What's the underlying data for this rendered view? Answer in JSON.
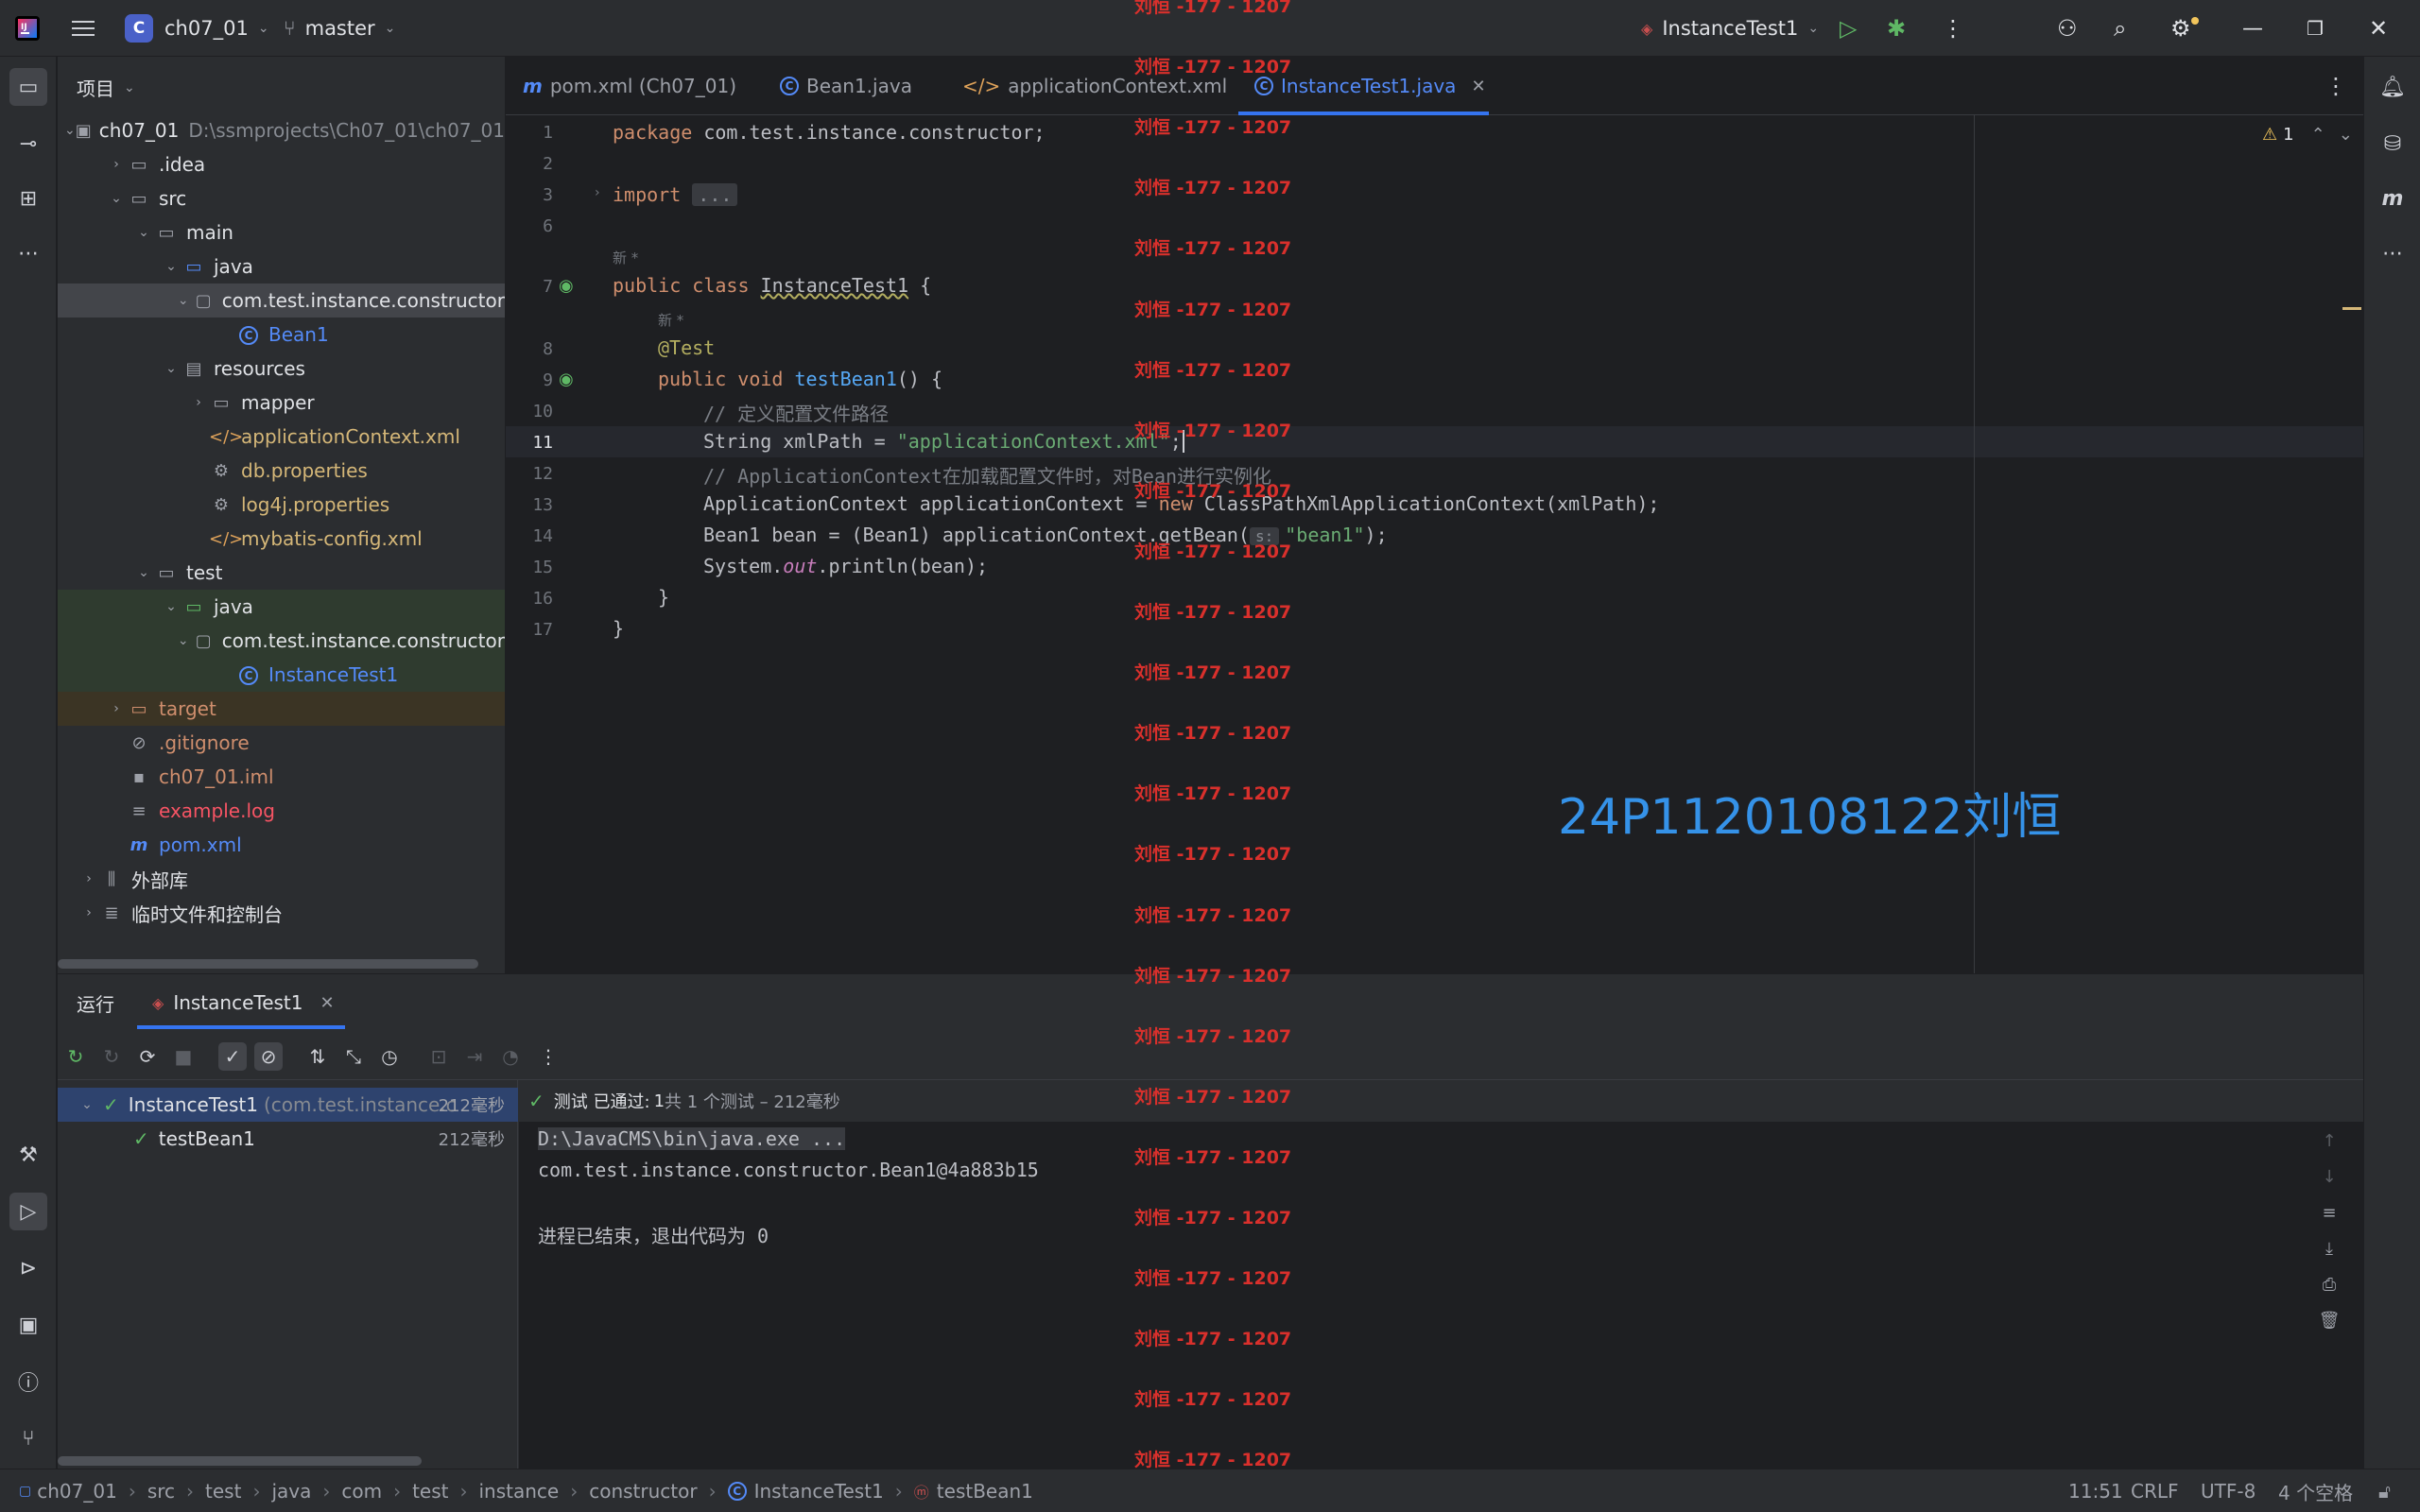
{
  "titlebar": {
    "project_badge": "C",
    "project_name": "ch07_01",
    "branch": "master",
    "run_config": "InstanceTest1"
  },
  "project_panel": {
    "title": "项目",
    "tree": [
      {
        "label": "ch07_01",
        "hint": "D:\\ssmprojects\\Ch07_01\\ch07_01",
        "depth": 0,
        "expanded": true,
        "icon": "module-folder-icon"
      },
      {
        "label": ".idea",
        "depth": 1,
        "expanded": false,
        "icon": "folder-icon"
      },
      {
        "label": "src",
        "depth": 1,
        "expanded": true,
        "icon": "folder-icon"
      },
      {
        "label": "main",
        "depth": 2,
        "expanded": true,
        "icon": "folder-icon"
      },
      {
        "label": "java",
        "depth": 3,
        "expanded": true,
        "icon": "source-folder-icon"
      },
      {
        "label": "com.test.instance.constructor",
        "depth": 4,
        "expanded": true,
        "icon": "package-icon",
        "selected": true
      },
      {
        "label": "Bean1",
        "depth": 5,
        "icon": "class-icon",
        "color": "blue"
      },
      {
        "label": "resources",
        "depth": 3,
        "expanded": true,
        "icon": "resources-folder-icon"
      },
      {
        "label": "mapper",
        "depth": 4,
        "expanded": false,
        "icon": "folder-icon"
      },
      {
        "label": "applicationContext.xml",
        "depth": 4,
        "icon": "xml-icon",
        "color": "yellow"
      },
      {
        "label": "db.properties",
        "depth": 4,
        "icon": "gear-icon",
        "color": "yellow"
      },
      {
        "label": "log4j.properties",
        "depth": 4,
        "icon": "gear-icon",
        "color": "yellow"
      },
      {
        "label": "mybatis-config.xml",
        "depth": 4,
        "icon": "xml-icon",
        "color": "yellow"
      },
      {
        "label": "test",
        "depth": 2,
        "expanded": true,
        "icon": "folder-icon"
      },
      {
        "label": "java",
        "depth": 3,
        "expanded": true,
        "icon": "test-folder-icon",
        "testbg": true
      },
      {
        "label": "com.test.instance.constructor",
        "depth": 4,
        "expanded": true,
        "icon": "package-icon",
        "testbg": true
      },
      {
        "label": "InstanceTest1",
        "depth": 5,
        "icon": "class-icon",
        "color": "blue",
        "testbg": true
      },
      {
        "label": "target",
        "depth": 1,
        "expanded": false,
        "icon": "folder-icon",
        "color": "orange",
        "targetbg": true
      },
      {
        "label": ".gitignore",
        "depth": 1,
        "icon": "ignore-icon",
        "color": "orange"
      },
      {
        "label": "ch07_01.iml",
        "depth": 1,
        "icon": "iml-icon",
        "color": "orange"
      },
      {
        "label": "example.log",
        "depth": 1,
        "icon": "log-icon",
        "color": "red"
      },
      {
        "label": "pom.xml",
        "depth": 1,
        "icon": "maven-icon",
        "color": "blue"
      },
      {
        "label": "外部库",
        "depth": 0,
        "expanded": false,
        "icon": "library-icon"
      },
      {
        "label": "临时文件和控制台",
        "depth": 0,
        "expanded": false,
        "icon": "scratch-icon"
      }
    ]
  },
  "editor": {
    "tabs": [
      {
        "label": "pom.xml (Ch07_01)",
        "icon": "maven-icon"
      },
      {
        "label": "Bean1.java",
        "icon": "class-icon"
      },
      {
        "label": "applicationContext.xml",
        "icon": "xml-icon"
      },
      {
        "label": "InstanceTest1.java",
        "icon": "class-icon",
        "active": true
      }
    ],
    "warning_count": "1",
    "line_numbers": [
      "1",
      "2",
      "3",
      "6",
      "7",
      "8",
      "9",
      "10",
      "11",
      "12",
      "13",
      "14",
      "15",
      "16",
      "17"
    ],
    "code": {
      "l1_kw": "package",
      "l1_rest": " com.test.instance.constructor;",
      "l3_kw": "import",
      "l3_fold": "...",
      "hint_new1": "新 *",
      "l7_kw": "public class",
      "l7_name": "InstanceTest1",
      "l7_rest": " {",
      "hint_new2": "新 *",
      "l8_ann": "@Test",
      "l9_kw": "public void",
      "l9_fn": "testBean1",
      "l9_rest": "() {",
      "l10_cmt": "// 定义配置文件路径",
      "l11_a": "String xmlPath = ",
      "l11_str": "\"applicationContext.xml\"",
      "l11_b": ";",
      "l12_cmt": "// ApplicationContext在加载配置文件时，对Bean进行实例化",
      "l13_a": "ApplicationContext applicationContext = ",
      "l13_kw": "new",
      "l13_b": " ClassPathXmlApplicationContext(xmlPath);",
      "l14_a": "Bean1 bean = (Bean1) applicationContext.getBean(",
      "l14_hint": "s:",
      "l14_str": "\"bean1\"",
      "l14_b": ");",
      "l15_a": "System.",
      "l15_fld": "out",
      "l15_b": ".println(bean);",
      "l16": "}",
      "l17": "}"
    },
    "watermark": "24P1120108122刘恒"
  },
  "red_overlay": "刘恒 -177 - 1207",
  "run_panel": {
    "title": "运行",
    "tab_label": "InstanceTest1",
    "tree": {
      "root_label": "InstanceTest1",
      "root_hint": "(com.test.instance.c",
      "root_duration": "212毫秒",
      "child_label": "testBean1",
      "child_duration": "212毫秒"
    },
    "status": {
      "passed_label": "测试 已通过:",
      "passed_count": "1",
      "summary": "共 1 个测试 – 212毫秒"
    },
    "console": [
      "D:\\JavaCMS\\bin\\java.exe ...",
      "com.test.instance.constructor.Bean1@4a883b15",
      "",
      "进程已结束，退出代码为 0"
    ]
  },
  "statusbar": {
    "breadcrumbs": [
      "ch07_01",
      "src",
      "test",
      "java",
      "com",
      "test",
      "instance",
      "constructor",
      "InstanceTest1",
      "testBean1"
    ],
    "position": "11:51",
    "line_ending": "CRLF",
    "encoding": "UTF-8",
    "indent": "4 个空格"
  }
}
